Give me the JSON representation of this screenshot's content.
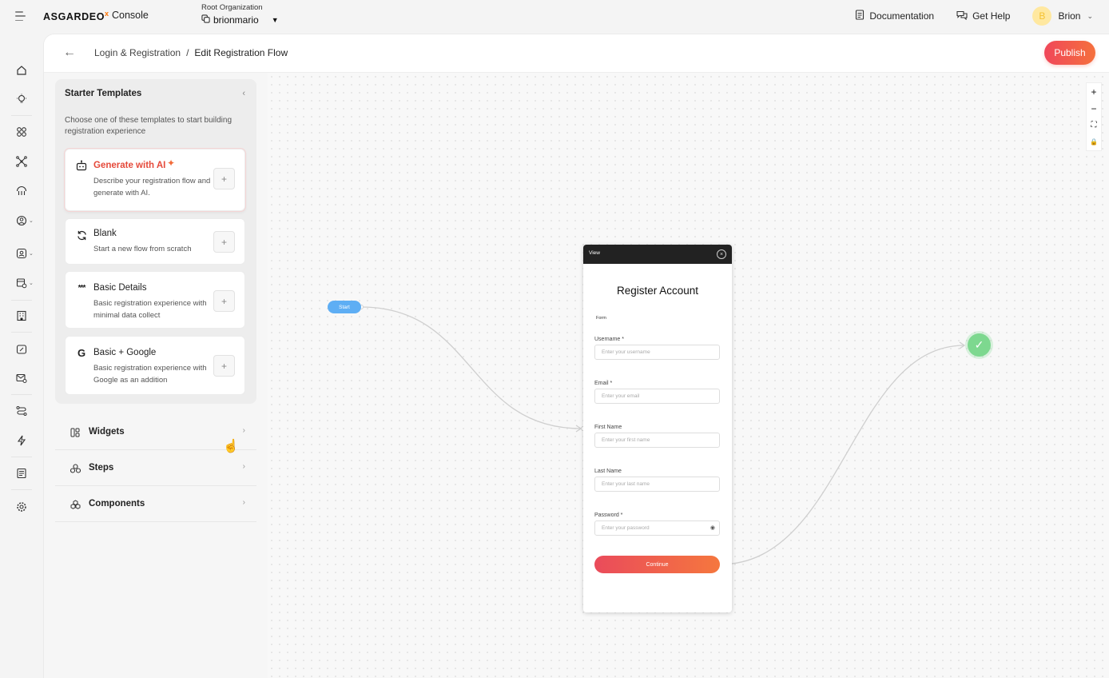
{
  "app": {
    "logo_text": "ASGARDEO",
    "logo_mark": "x",
    "product": "Console"
  },
  "org": {
    "label": "Root Organization",
    "name": "brionmario"
  },
  "topbar": {
    "documentation": "Documentation",
    "get_help": "Get Help",
    "user_initial": "B",
    "user_name": "Brion"
  },
  "header": {
    "breadcrumb_parent": "Login & Registration",
    "separator": "/",
    "breadcrumb_current": "Edit Registration Flow",
    "publish_label": "Publish"
  },
  "templates": {
    "title": "Starter Templates",
    "description": "Choose one of these templates to start building registration experience",
    "items": [
      {
        "title": "Generate with AI",
        "description": "Describe your registration flow and generate with AI.",
        "icon": "ai-robot-icon"
      },
      {
        "title": "Blank",
        "description": "Start a new flow from scratch",
        "icon": "refresh-icon"
      },
      {
        "title": "Basic Details",
        "description": "Basic registration experience with minimal data collect",
        "icon": "password-dots-icon"
      },
      {
        "title": "Basic + Google",
        "description": "Basic registration experience with Google as an addition",
        "icon": "google-icon"
      }
    ]
  },
  "sections": [
    {
      "label": "Widgets",
      "icon": "widgets-icon"
    },
    {
      "label": "Steps",
      "icon": "steps-icon"
    },
    {
      "label": "Components",
      "icon": "components-icon"
    }
  ],
  "canvas": {
    "start_label": "Start",
    "view_header": "View",
    "view_title": "Register Account",
    "form_label": "Form",
    "fields": [
      {
        "label": "Username *",
        "placeholder": "Enter your username"
      },
      {
        "label": "Email *",
        "placeholder": "Enter your email"
      },
      {
        "label": "First Name",
        "placeholder": "Enter your first name"
      },
      {
        "label": "Last Name",
        "placeholder": "Enter your last name"
      },
      {
        "label": "Password *",
        "placeholder": "Enter your password"
      }
    ],
    "continue_label": "Continue"
  },
  "zoom_controls": [
    "+",
    "−",
    "⛶",
    "🔒"
  ],
  "colors": {
    "accent": "#f0475a",
    "start_node": "#5eaef4",
    "end_node": "#7dd88f",
    "ai_title": "#e5493a"
  }
}
